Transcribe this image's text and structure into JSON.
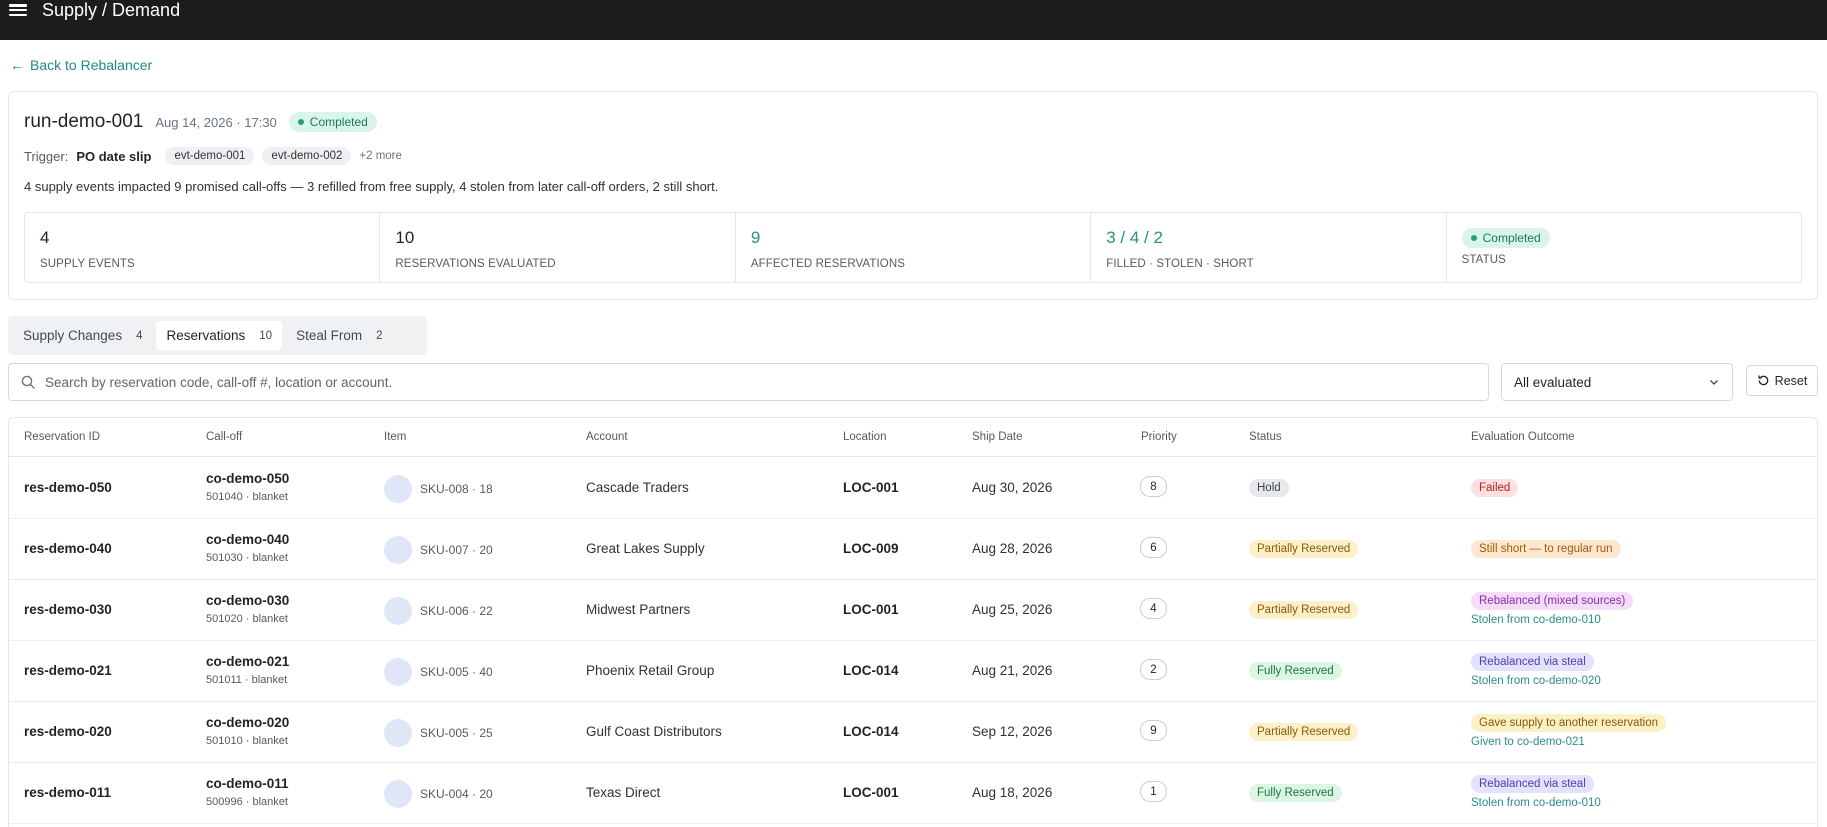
{
  "app": {
    "title": "Supply / Demand"
  },
  "nav": {
    "back_label": "Back to Rebalancer"
  },
  "run": {
    "id": "run-demo-001",
    "date": "Aug 14, 2026 · 17:30",
    "status": "Completed",
    "trigger_label": "Trigger:",
    "trigger_value": "PO date slip",
    "events": [
      "evt-demo-001",
      "evt-demo-002"
    ],
    "more": "+2 more",
    "summary": "4 supply events impacted 9 promised call-offs — 3 refilled from free supply, 4 stolen from later call-off orders, 2 still short."
  },
  "stats": [
    {
      "value": "4",
      "label": "SUPPLY EVENTS"
    },
    {
      "value": "10",
      "label": "RESERVATIONS EVALUATED"
    },
    {
      "value": "9",
      "label": "AFFECTED RESERVATIONS"
    },
    {
      "value": "3 / 4 / 2",
      "label": "FILLED · STOLEN · SHORT"
    },
    {
      "value": "Completed",
      "label": "STATUS"
    }
  ],
  "tabs": [
    {
      "label": "Supply Changes",
      "count": "4"
    },
    {
      "label": "Reservations",
      "count": "10"
    },
    {
      "label": "Steal From",
      "count": "2"
    }
  ],
  "search": {
    "placeholder": "Search by reservation code, call-off #, location or account.",
    "value": ""
  },
  "filter": {
    "selected": "All evaluated"
  },
  "reset_label": "Reset",
  "icons": {
    "menu": "hamburger-icon",
    "back": "arrow-left-icon",
    "search": "search-icon",
    "dropdown": "chevron-down-icon",
    "reset": "refresh-icon",
    "status_dot": "dot-icon"
  },
  "colors": {
    "accent": "#2a8f84",
    "topbar": "#1c1c1c",
    "completed_bg": "#d9f5ea"
  },
  "table": {
    "columns": [
      "Reservation ID",
      "Call-off",
      "Item",
      "Account",
      "Location",
      "Ship Date",
      "Priority",
      "Status",
      "Evaluation Outcome"
    ],
    "rows": [
      {
        "res": "res-demo-050",
        "calloff": "co-demo-050",
        "calloff_sub": "501040 · blanket",
        "item": "SKU-008 · 18",
        "account": "Cascade Traders",
        "location": "LOC-001",
        "ship": "Aug 30, 2026",
        "priority": "8",
        "status": "Hold",
        "status_kind": "hold",
        "outcome": "Failed",
        "outcome_kind": "failed",
        "outcome_sub": ""
      },
      {
        "res": "res-demo-040",
        "calloff": "co-demo-040",
        "calloff_sub": "501030 · blanket",
        "item": "SKU-007 · 20",
        "account": "Great Lakes Supply",
        "location": "LOC-009",
        "ship": "Aug 28, 2026",
        "priority": "6",
        "status": "Partially Reserved",
        "status_kind": "partial",
        "outcome": "Still short — to regular run",
        "outcome_kind": "short",
        "outcome_sub": ""
      },
      {
        "res": "res-demo-030",
        "calloff": "co-demo-030",
        "calloff_sub": "501020 · blanket",
        "item": "SKU-006 · 22",
        "account": "Midwest Partners",
        "location": "LOC-001",
        "ship": "Aug 25, 2026",
        "priority": "4",
        "status": "Partially Reserved",
        "status_kind": "partial",
        "outcome": "Rebalanced (mixed sources)",
        "outcome_kind": "mixed",
        "outcome_sub": "Stolen from co-demo-010"
      },
      {
        "res": "res-demo-021",
        "calloff": "co-demo-021",
        "calloff_sub": "501011 · blanket",
        "item": "SKU-005 · 40",
        "account": "Phoenix Retail Group",
        "location": "LOC-014",
        "ship": "Aug 21, 2026",
        "priority": "2",
        "status": "Fully Reserved",
        "status_kind": "full",
        "outcome": "Rebalanced via steal",
        "outcome_kind": "steal",
        "outcome_sub": "Stolen from co-demo-020"
      },
      {
        "res": "res-demo-020",
        "calloff": "co-demo-020",
        "calloff_sub": "501010 · blanket",
        "item": "SKU-005 · 25",
        "account": "Gulf Coast Distributors",
        "location": "LOC-014",
        "ship": "Sep 12, 2026",
        "priority": "9",
        "status": "Partially Reserved",
        "status_kind": "partial",
        "outcome": "Gave supply to another reservation",
        "outcome_kind": "gave",
        "outcome_sub": "Given to co-demo-021"
      },
      {
        "res": "res-demo-011",
        "calloff": "co-demo-011",
        "calloff_sub": "500996 · blanket",
        "item": "SKU-004 · 20",
        "account": "Texas Direct",
        "location": "LOC-001",
        "ship": "Aug 18, 2026",
        "priority": "1",
        "status": "Fully Reserved",
        "status_kind": "full",
        "outcome": "Rebalanced via steal",
        "outcome_kind": "steal",
        "outcome_sub": "Stolen from co-demo-010"
      }
    ]
  }
}
